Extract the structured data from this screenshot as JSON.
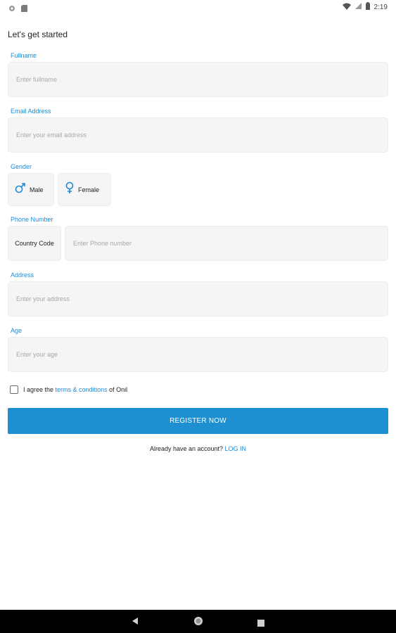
{
  "status_bar": {
    "time": "2:19"
  },
  "form": {
    "title": "Let's get started",
    "fullname": {
      "label": "Fullname",
      "placeholder": "Enter fullname"
    },
    "email": {
      "label": "Email Address",
      "placeholder": "Enter your email address"
    },
    "gender": {
      "label": "Gender",
      "options": [
        {
          "label": "Male",
          "icon": "male-icon"
        },
        {
          "label": "Female",
          "icon": "female-icon"
        }
      ]
    },
    "phone": {
      "label": "Phone Number",
      "country_code": "Country Code",
      "placeholder": "Enter Phone number"
    },
    "address": {
      "label": "Address",
      "placeholder": "Enter your address"
    },
    "age": {
      "label": "Age",
      "placeholder": "Enter your age"
    },
    "agree": {
      "prefix": "I agree the",
      "link": "terms & conditions",
      "suffix": "of Onil"
    },
    "register_label": "REGISTER NOW",
    "login": {
      "prompt": "Already have an account?",
      "link": "LOG IN"
    }
  },
  "colors": {
    "accent": "#1e8fd0",
    "label": "#1e8ad6",
    "field_bg": "#f6f5f5",
    "nav_bar": "#000000"
  }
}
